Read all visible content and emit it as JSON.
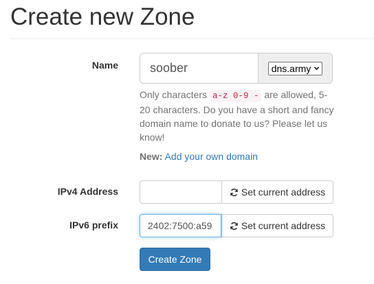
{
  "page": {
    "title": "Create new Zone"
  },
  "name_field": {
    "label": "Name",
    "value": "soober",
    "domain_selected": "dns.army"
  },
  "help": {
    "prefix": "Only characters ",
    "allowed_chars": "a-z 0-9 -",
    "suffix": " are allowed, 5-20 characters. Do you have a short and fancy domain name to donate to us? Please let us know!"
  },
  "new_domain": {
    "label": "New:",
    "link_text": "Add your own domain"
  },
  "ipv4": {
    "label": "IPv4 Address",
    "value": "",
    "button_label": "Set current address"
  },
  "ipv6": {
    "label": "IPv6 prefix",
    "value": "2402:7500:a59",
    "button_label": "Set current address"
  },
  "submit": {
    "label": "Create Zone"
  },
  "icons": {
    "refresh": "refresh-icon",
    "dropdown": "chevron-down-icon"
  },
  "colors": {
    "primary": "#337ab7",
    "link": "#337ab7",
    "code_text": "#c7254e",
    "code_bg": "#f9f2f4",
    "focus": "#66afe9"
  }
}
